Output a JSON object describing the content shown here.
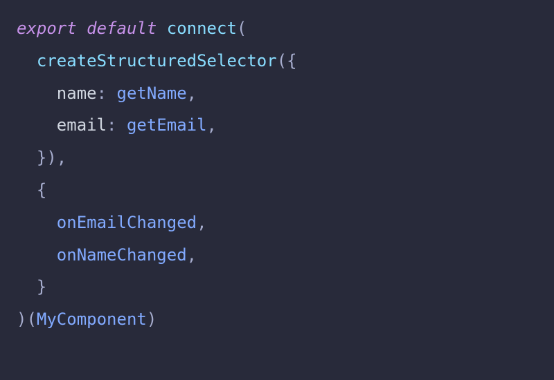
{
  "code": {
    "lines": [
      {
        "indent": 0,
        "tokens": [
          {
            "cls": "kw",
            "t": "export default "
          },
          {
            "cls": "fn",
            "t": "connect"
          },
          {
            "cls": "punc",
            "t": "("
          }
        ]
      },
      {
        "indent": 1,
        "tokens": [
          {
            "cls": "fn",
            "t": "createStructuredSelector"
          },
          {
            "cls": "punc",
            "t": "({"
          }
        ]
      },
      {
        "indent": 2,
        "tokens": [
          {
            "cls": "prop",
            "t": "name"
          },
          {
            "cls": "punc",
            "t": ": "
          },
          {
            "cls": "ident",
            "t": "getName"
          },
          {
            "cls": "punc",
            "t": ","
          }
        ]
      },
      {
        "indent": 2,
        "tokens": [
          {
            "cls": "prop",
            "t": "email"
          },
          {
            "cls": "punc",
            "t": ": "
          },
          {
            "cls": "ident",
            "t": "getEmail"
          },
          {
            "cls": "punc",
            "t": ","
          }
        ]
      },
      {
        "indent": 1,
        "tokens": [
          {
            "cls": "punc",
            "t": "}),"
          }
        ]
      },
      {
        "indent": 1,
        "tokens": [
          {
            "cls": "punc",
            "t": "{"
          }
        ]
      },
      {
        "indent": 2,
        "tokens": [
          {
            "cls": "ident",
            "t": "onEmailChanged"
          },
          {
            "cls": "punc",
            "t": ","
          }
        ]
      },
      {
        "indent": 2,
        "tokens": [
          {
            "cls": "ident",
            "t": "onNameChanged"
          },
          {
            "cls": "punc",
            "t": ","
          }
        ]
      },
      {
        "indent": 1,
        "tokens": [
          {
            "cls": "punc",
            "t": "}"
          }
        ]
      },
      {
        "indent": 0,
        "tokens": [
          {
            "cls": "punc",
            "t": ")("
          },
          {
            "cls": "ident",
            "t": "MyComponent"
          },
          {
            "cls": "punc",
            "t": ")"
          }
        ]
      }
    ],
    "indent_unit": "  "
  }
}
